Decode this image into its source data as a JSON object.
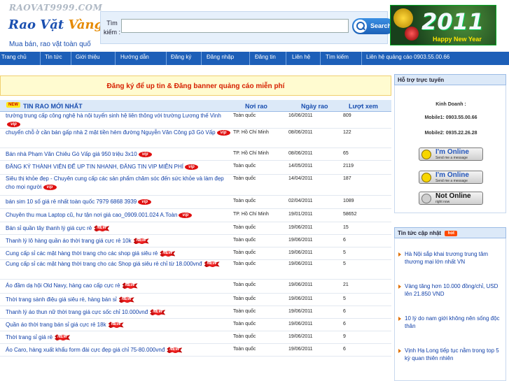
{
  "header": {
    "logo_top": "RAOVAT9999.COM",
    "logo_part1": "Rao Vặt",
    "logo_part2": "Vàng",
    "tagline": "Mua bán, rao vặt toàn quố",
    "search_label": "Tìm kiếm :",
    "search_value": "",
    "search_button": "Search",
    "banner_year": "2011",
    "banner_text": "Happy New Year"
  },
  "nav": {
    "items": [
      "Trang chủ",
      "Tin tức",
      "Giới thiệu",
      "Hướng dẫn",
      "Đăng ký",
      "Đăng nhập",
      "Đăng tin",
      "Liên hệ",
      "Tìm kiếm",
      "Liên hệ quảng cáo 0903.55.00.66"
    ]
  },
  "promo": "Đăng ký để up tin & Đăng banner quảng cáo miễn phí",
  "list": {
    "badge": "NEW",
    "title": "TIN RAO MỚI NHẤT",
    "col_location": "Nơi rao",
    "col_date": "Ngày rao",
    "col_views": "Lượt xem",
    "rows": [
      {
        "title": "trường trung cấp công nghệ hà nội tuyển sinh hệ liên thông với trường Lương thế Vinh",
        "badge": "vip",
        "location": "Toàn quốc",
        "date": "16/06/2011",
        "views": "809"
      },
      {
        "title": "chuyển chỗ ở cần bán gấp nhà 2 mặt tiền hẻm đường Nguyễn Văn Công p3 Gò Vấp",
        "badge": "vip",
        "location": "TP. Hồ Chí Minh",
        "date": "08/06/2011",
        "views": "122"
      },
      {
        "title": "Bán nhà Phạm Văn Chiêu Gò Vấp giá 950 triệu 3x10",
        "badge": "vip",
        "location": "TP. Hồ Chí Minh",
        "date": "08/06/2011",
        "views": "65"
      },
      {
        "title": "ĐĂNG KÝ THÀNH VIÊN ĐỂ UP TIN NHANH, ĐĂNG TIN VIP MIỄN PHÍ",
        "badge": "vip",
        "location": "Toàn quốc",
        "date": "14/05/2011",
        "views": "2119"
      },
      {
        "title": "Siêu thị khỏe đẹp - Chuyên cung cấp các sản phẩm chăm sóc đến sức khỏe và làm đẹp cho mọi người",
        "badge": "vip",
        "location": "Toàn quốc",
        "date": "14/04/2011",
        "views": "187"
      },
      {
        "title": "bán sim 10 số giá rẻ nhất toàn quốc 7979 6868 3939",
        "badge": "vip",
        "location": "Toàn quốc",
        "date": "02/04/2011",
        "views": "1089"
      },
      {
        "title": "Chuyên thu mua Laptop cũ, hư tận nơi giá cao_0909.001.024 A.Toàn",
        "badge": "vip",
        "location": "TP. Hồ Chí Minh",
        "date": "19/01/2011",
        "views": "58652"
      },
      {
        "title": "Bán sỉ quần tây thanh lý giá cực rẻ",
        "badge": "new",
        "location": "Toàn quốc",
        "date": "19/06/2011",
        "views": "15"
      },
      {
        "title": "Thanh lý lô hàng quần áo thời trang giá cực rẻ 10k",
        "badge": "new",
        "location": "Toàn quốc",
        "date": "19/06/2011",
        "views": "6"
      },
      {
        "title": "Cung cấp sỉ các mặt hàng thời trang cho các shop giá siêu rẻ",
        "badge": "new",
        "location": "Toàn quốc",
        "date": "19/06/2011",
        "views": "5"
      },
      {
        "title": "Cung cấp sỉ các mặt hàng thời trang cho các Shop giá siêu rẻ chỉ từ 18.000vnđ",
        "badge": "new",
        "location": "Toàn quốc",
        "date": "19/06/2011",
        "views": "5"
      },
      {
        "title": "Áo đầm dạ hội Old Navy, hàng cao cấp cực rẻ",
        "badge": "new",
        "location": "Toàn quốc",
        "date": "19/06/2011",
        "views": "21"
      },
      {
        "title": "Thời trang sành điệu giá siêu rẻ, hàng bán sỉ",
        "badge": "new",
        "location": "Toàn quốc",
        "date": "19/06/2011",
        "views": "5"
      },
      {
        "title": "Thanh lý áo thun nữ thời trang giá cực sốc chỉ 10.000vnđ",
        "badge": "new",
        "location": "Toàn quốc",
        "date": "19/06/2011",
        "views": "6"
      },
      {
        "title": "Quần áo thời trang bán sỉ giá cực rẻ 18k",
        "badge": "new",
        "location": "Toàn quốc",
        "date": "19/06/2011",
        "views": "6"
      },
      {
        "title": "Thời trang sỉ giá rẻ",
        "badge": "new",
        "location": "Toàn quốc",
        "date": "19/06/2011",
        "views": "9"
      },
      {
        "title": "Áo Caro, hàng xuất khẩu form đài cực đẹp giá chỉ 75-80.000vnđ",
        "badge": "new",
        "location": "Toàn quốc",
        "date": "19/06/2011",
        "views": "6"
      }
    ]
  },
  "support": {
    "title": "Hỗ trợ trực tuyến",
    "label": "Kinh Doanh :",
    "mobile1": "Mobile1: 0903.55.00.66",
    "mobile2": "Mobile2: 0935.22.26.28",
    "status1_main": "I'm Online",
    "status1_sub": "Send me a message",
    "status2_main": "I'm Online",
    "status2_sub": "Send me a message",
    "status3_main": "Not Online",
    "status3_sub": "right now"
  },
  "news": {
    "title": "Tin tức cập nhật",
    "hot_badge": "hot",
    "items": [
      "Hà Nội sắp khai trương trung tâm thương mại lớn nhất VN",
      "Vàng tăng hơn 10.000 đồng/chỉ, USD lên 21.850 VND",
      "10 lý do nam giới không nên sống độc thân",
      "Vịnh Hạ Long tiếp tục nằm trong top 5 kỳ quan thiên nhiên"
    ]
  },
  "colors": {
    "nav_bg": "#1d5fb8",
    "link": "#1140a8",
    "promo_text": "#d62000",
    "vip_badge": "#e01010"
  },
  "icons": {
    "search": "search-icon",
    "vip": "vip-badge-icon",
    "new": "new-badge-icon",
    "messenger": "messenger-smiley-icon",
    "bullet": "bullet-arrow-icon"
  }
}
